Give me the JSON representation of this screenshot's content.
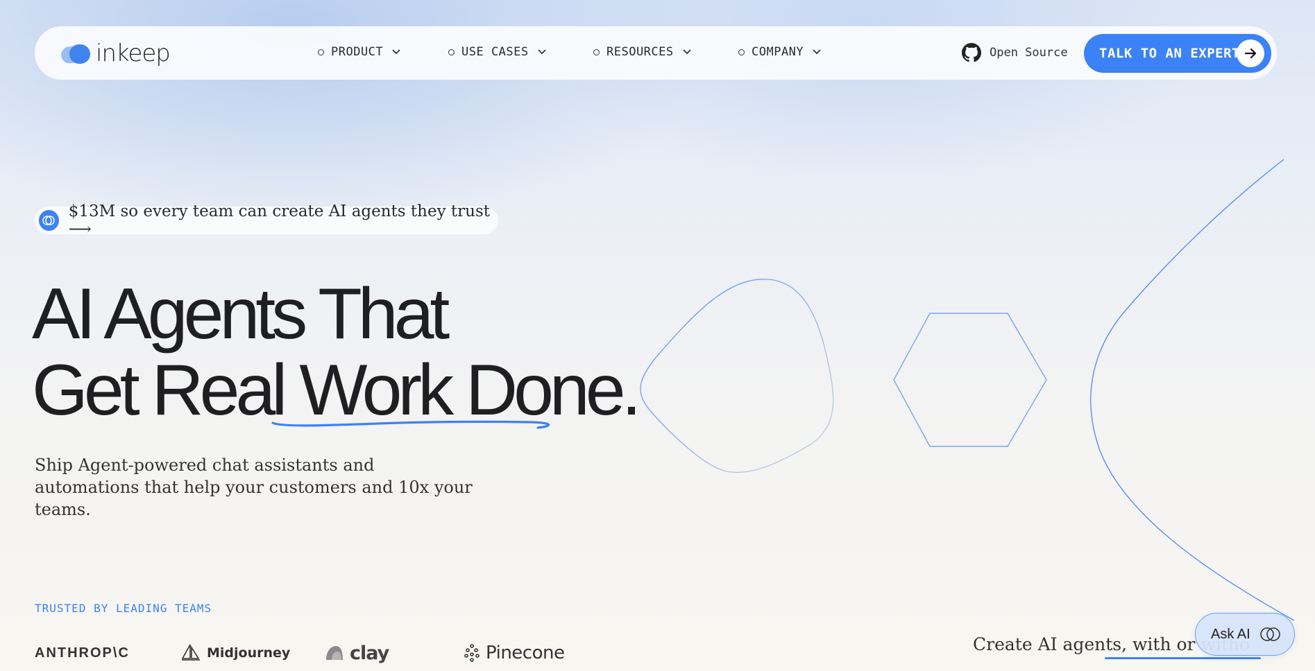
{
  "brand": {
    "name": "inkeep"
  },
  "nav": {
    "items": [
      {
        "label": "PRODUCT"
      },
      {
        "label": "USE CASES"
      },
      {
        "label": "RESOURCES"
      },
      {
        "label": "COMPANY"
      }
    ],
    "open_source_label": "Open Source",
    "cta_label": "TALK TO AN EXPERT"
  },
  "announcement": {
    "text": "$13M so every team can create AI agents they trust ⟶"
  },
  "hero": {
    "title_line1": "AI Agents That",
    "title_line2_a": "Get Real ",
    "title_line2_b": "Work Done",
    "title_line2_c": ".",
    "subtitle": "Ship Agent-powered chat assistants and automations that help your customers and 10x your teams."
  },
  "trusted": {
    "heading": "TRUSTED BY LEADING TEAMS",
    "logos": [
      "ANTHROP\\C",
      "Midjourney",
      "clay",
      "Pinecone"
    ]
  },
  "create_text": "Create AI agents, with or witho",
  "ask_ai_label": "Ask AI",
  "colors": {
    "accent": "#3b82f6",
    "text": "#1f1f22"
  },
  "icons": [
    "github-icon",
    "arrow-right-icon",
    "chevron-down-icon",
    "inkeep-logo-icon",
    "ask-ai-rings-icon"
  ]
}
